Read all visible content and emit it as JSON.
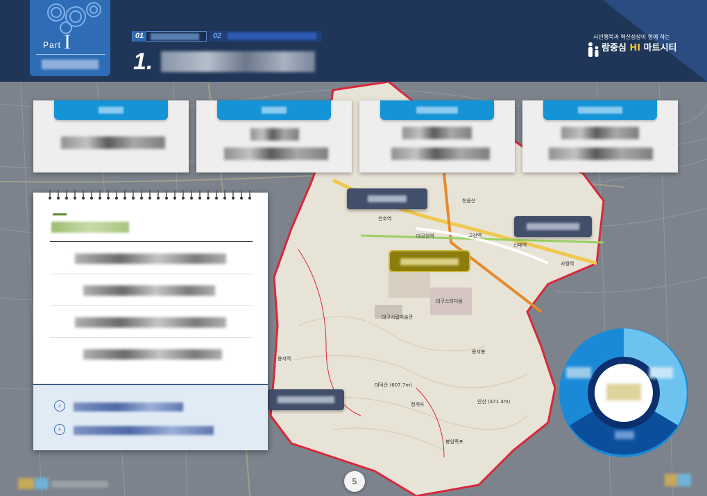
{
  "header": {
    "part_label": "Part",
    "part_number": "I",
    "crumb_1_number": "01",
    "crumb_2_number": "02",
    "section_number": "1.",
    "brand_tagline": "시민행복과 혁신성장이 함께 하는",
    "brand_name_prefix": "람중심",
    "brand_hi": "HI",
    "brand_name_suffix": "마트시티"
  },
  "map": {
    "place_labels": [
      "연호역",
      "대공원역",
      "고산역",
      "신매역",
      "사월역",
      "대구시립미술관",
      "대구스타디움",
      "용지역",
      "대덕산 (607.7m)",
      "청계사",
      "용지봉",
      "봉암폭포",
      "안산 (471.4m)",
      "천을산"
    ]
  },
  "page": {
    "number": "5"
  },
  "colors": {
    "header_bg": "#1f3658",
    "part_box": "#2e6db6",
    "card_tab": "#1494d6",
    "map_outline": "#d8283a",
    "center_tag": "#8c7d0d",
    "donut_dark": "#0b4f9c",
    "donut_mid": "#1b8ad6",
    "donut_light": "#6dc3f0"
  },
  "icons": {
    "nb_link": "chevron-right-circle-icon",
    "brand": "family-person-icon"
  }
}
